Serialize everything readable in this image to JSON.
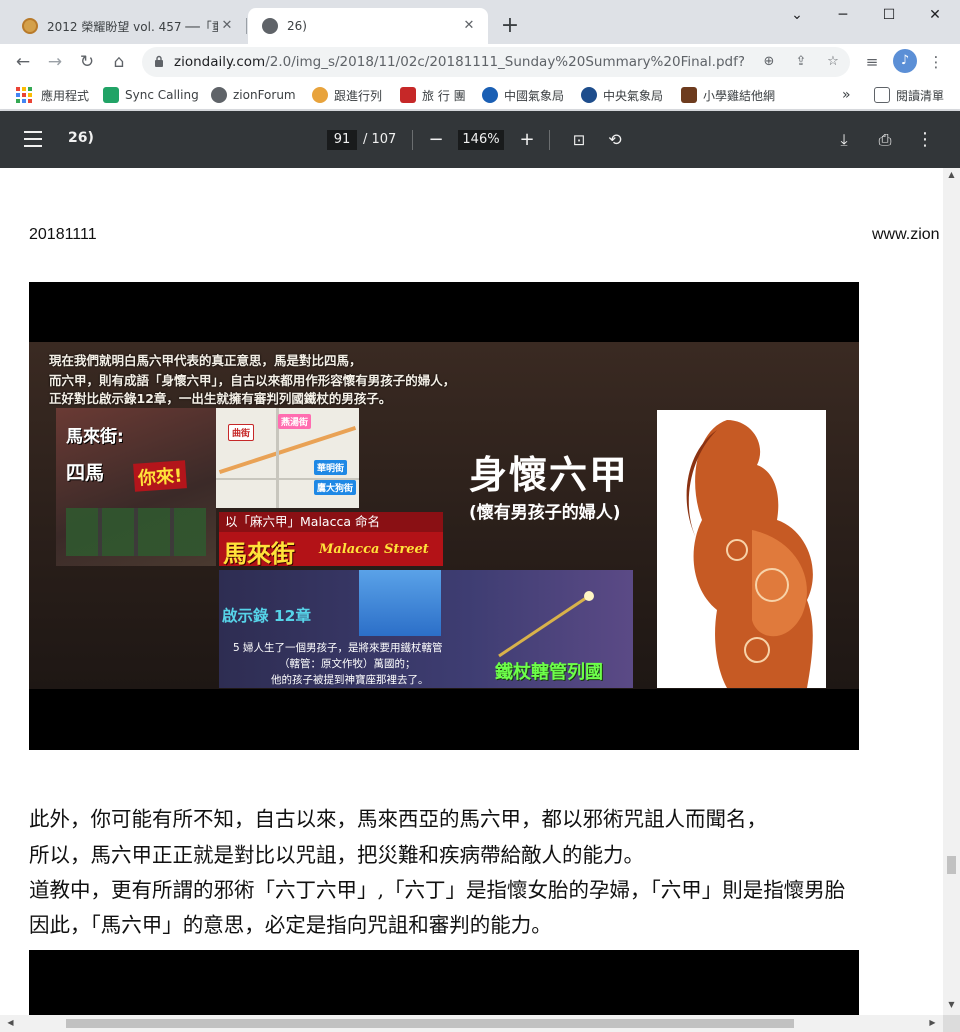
{
  "tabs": [
    {
      "title": "2012 榮耀盼望 vol. 457 ──「重",
      "active": false,
      "favicon_color": "#d4a04a"
    },
    {
      "title": "26)",
      "active": true,
      "favicon_color": "#5f6368"
    }
  ],
  "window_controls": {
    "minimize": "─",
    "maximize": "☐",
    "close": "✕",
    "tabsearch": "⌄"
  },
  "address": {
    "host": "ziondaily.com",
    "path": "/2.0/img_s/2018/11/02c/20181111_Sunday%20Summary%20Final.pdf?..."
  },
  "bookmarks": [
    {
      "label": "應用程式",
      "color": "#4285f4"
    },
    {
      "label": "Sync Calling",
      "color": "#21a366"
    },
    {
      "label": "zionForum",
      "color": "#5f6368"
    },
    {
      "label": "跟進行列",
      "color": "#e8a33c"
    },
    {
      "label": "旅 行 團",
      "color": "#c62828"
    },
    {
      "label": "中國氣象局",
      "color": "#1a5fb4"
    },
    {
      "label": "中央氣象局",
      "color": "#1e4d8c"
    },
    {
      "label": "小學雞結他網",
      "color": "#6d3b1e"
    }
  ],
  "bookmarks_overflow": "»",
  "reading_list": "閱讀清單",
  "pdf": {
    "title": "26)",
    "current_page": "91",
    "total_pages": "/ 107",
    "zoom": "146%"
  },
  "page": {
    "header_date": "20181111",
    "header_site": "www.zion"
  },
  "slide": {
    "lines": [
      "現在我們就明白馬六甲代表的真正意思，馬是對比四馬，",
      "而六甲，則有成語「身懷六甲」，自古以來都用作形容懷有男孩子的婦人，",
      "正好對比啟示錄12章，一出生就擁有審判列國鐵杖的男孩子。"
    ],
    "street_title": "馬來街:",
    "sima": "四馬",
    "nilai": "你來!",
    "map_tags": [
      "曲街",
      "燕湯街",
      "華明街",
      "鷹大狗街"
    ],
    "malacca_label": "以「麻六甲」Malacca 命名",
    "malacca_cn": "馬來街",
    "malacca_en": "Malacca Street",
    "big_title": "身懷六甲",
    "sub_title": "(懷有男孩子的婦人)",
    "rev_heading": "啟示錄 12章",
    "rev_lines": [
      "5 婦人生了一個男孩子，是將來要用鐵杖轄管",
      "（轄管：原文作牧）萬國的；",
      "他的孩子被提到神寶座那裡去了。"
    ],
    "iron_rod": "鐵杖轄管列國"
  },
  "paragraphs": [
    "此外，你可能有所不知，自古以來，馬來西亞的馬六甲，都以邪術咒詛人而聞名，",
    "所以，馬六甲正正就是對比以咒詛，把災難和疾病帶給敵人的能力。",
    "道教中，更有所謂的邪術「六丁六甲」,「六丁」是指懷女胎的孕婦，「六甲」則是指懷男胎",
    "因此，「馬六甲」的意思，必定是指向咒詛和審判的能力。"
  ]
}
